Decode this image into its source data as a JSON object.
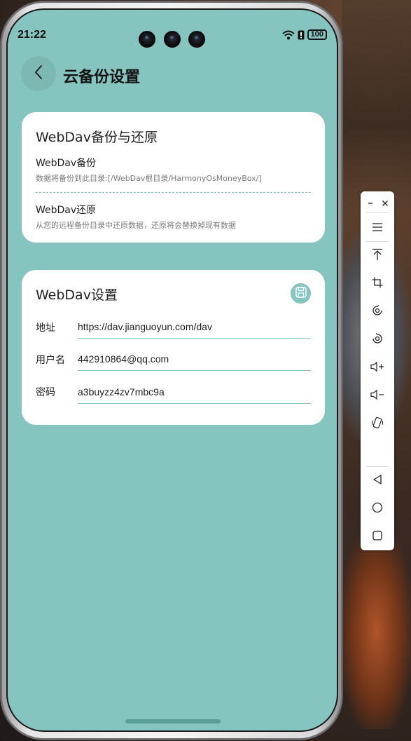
{
  "status_bar": {
    "time": "21:22",
    "battery": "100"
  },
  "header": {
    "title": "云备份设置"
  },
  "backup_card": {
    "title": "WebDav备份与还原",
    "backup": {
      "title": "WebDav备份",
      "desc": "数据将备份到此目录:[/WebDav根目录/HarmonyOsMoneyBox/]"
    },
    "restore": {
      "title": "WebDav还原",
      "desc": "从您的远程备份目录中还原数据，还原将会替换掉现有数据"
    }
  },
  "settings_card": {
    "title": "WebDav设置",
    "fields": [
      {
        "label": "地址",
        "value": "https://dav.jianguoyun.com/dav"
      },
      {
        "label": "用户名",
        "value": "442910864@qq.com"
      },
      {
        "label": "密码",
        "value": "a3buyzz4zv7mbc9a"
      }
    ]
  },
  "toolbar": {
    "items": [
      "minimize-icon",
      "close-icon",
      "menu-icon",
      "pin-top-icon",
      "crop-icon",
      "rotate-left-icon",
      "rotate-right-icon",
      "volume-up-icon",
      "volume-down-icon",
      "shake-icon",
      "back-icon",
      "home-icon",
      "recents-icon"
    ]
  },
  "colors": {
    "accent": "#86c4bf",
    "card": "#ffffff",
    "title": "#151515"
  }
}
